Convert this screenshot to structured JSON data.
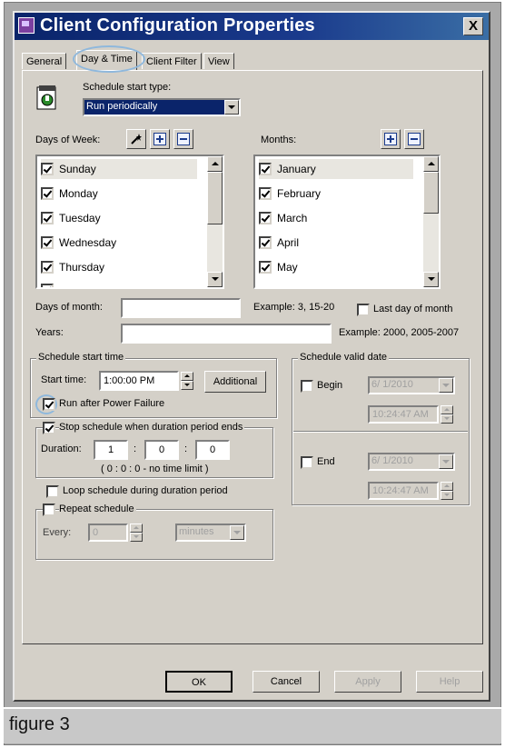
{
  "window": {
    "title": "Client Configuration Properties",
    "close_label": "X"
  },
  "tabs": [
    {
      "label": "General"
    },
    {
      "label": "Day & Time",
      "active": true
    },
    {
      "label": "Client Filter"
    },
    {
      "label": "View"
    }
  ],
  "schedule_type": {
    "label": "Schedule start type:",
    "value": "Run periodically"
  },
  "days_of_week": {
    "label": "Days of Week:",
    "items": [
      {
        "label": "Sunday",
        "checked": true
      },
      {
        "label": "Monday",
        "checked": true
      },
      {
        "label": "Tuesday",
        "checked": true
      },
      {
        "label": "Wednesday",
        "checked": true
      },
      {
        "label": "Thursday",
        "checked": true
      }
    ]
  },
  "months": {
    "label": "Months:",
    "items": [
      {
        "label": "January",
        "checked": true
      },
      {
        "label": "February",
        "checked": true
      },
      {
        "label": "March",
        "checked": true
      },
      {
        "label": "April",
        "checked": true
      },
      {
        "label": "May",
        "checked": true
      }
    ]
  },
  "days_of_month": {
    "label": "Days of month:",
    "value": "",
    "example": "Example: 3, 15-20"
  },
  "last_day": {
    "label": "Last day of month",
    "checked": false
  },
  "years": {
    "label": "Years:",
    "value": "",
    "example": "Example: 2000, 2005-2007"
  },
  "start_time_group": {
    "title": "Schedule start time",
    "start_label": "Start time:",
    "start_value": "1:00:00 PM",
    "additional_label": "Additional",
    "run_after_power_failure": {
      "label": "Run after Power Failure",
      "checked": true
    }
  },
  "duration_group": {
    "stop_label": "Stop schedule when duration period ends",
    "stop_checked": true,
    "duration_label": "Duration:",
    "hours": "1",
    "minutes": "0",
    "seconds": "0",
    "colon": ":",
    "summary": "( 0 : 0 : 0 - no time limit )"
  },
  "loop_schedule": {
    "label": "Loop schedule during duration period",
    "checked": false
  },
  "repeat_group": {
    "label": "Repeat schedule",
    "checked": false,
    "every_label": "Every:",
    "every_value": "0",
    "unit": "minutes"
  },
  "valid_date_group": {
    "title": "Schedule valid date",
    "begin_label": "Begin",
    "begin_checked": false,
    "begin_date": "6/ 1/2010",
    "begin_time": "10:24:47 AM",
    "end_label": "End",
    "end_checked": false,
    "end_date": "6/ 1/2010",
    "end_time": "10:24:47 AM"
  },
  "buttons": {
    "ok": "OK",
    "cancel": "Cancel",
    "apply": "Apply",
    "help": "Help"
  },
  "caption": "figure 3",
  "colors": {
    "title_bar": "#0a246a",
    "selection": "#0a246a",
    "dialog_bg": "#d4d0c8",
    "highlight_circle": "#8fb8dc"
  }
}
